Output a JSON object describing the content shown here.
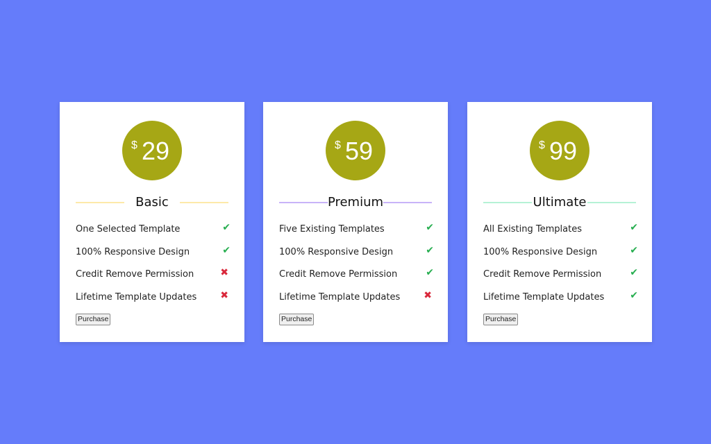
{
  "plans": [
    {
      "currency": "$",
      "price": "29",
      "name": "Basic",
      "accent": "#fde9a9",
      "features": [
        {
          "label": "One Selected Template",
          "included": true
        },
        {
          "label": "100% Responsive Design",
          "included": true
        },
        {
          "label": "Credit Remove Permission",
          "included": false
        },
        {
          "label": "Lifetime Template Updates",
          "included": false
        }
      ],
      "button": "Purchase"
    },
    {
      "currency": "$",
      "price": "59",
      "name": "Premium",
      "accent": "#c8b3f8",
      "features": [
        {
          "label": "Five Existing Templates",
          "included": true
        },
        {
          "label": "100% Responsive Design",
          "included": true
        },
        {
          "label": "Credit Remove Permission",
          "included": true
        },
        {
          "label": "Lifetime Template Updates",
          "included": false
        }
      ],
      "button": "Purchase"
    },
    {
      "currency": "$",
      "price": "99",
      "name": "Ultimate",
      "accent": "#b5f2d5",
      "features": [
        {
          "label": "All Existing Templates",
          "included": true
        },
        {
          "label": "100% Responsive Design",
          "included": true
        },
        {
          "label": "Credit Remove Permission",
          "included": true
        },
        {
          "label": "Lifetime Template Updates",
          "included": true
        }
      ],
      "button": "Purchase"
    }
  ],
  "icons": {
    "check": "✔",
    "cross": "✖"
  },
  "colors": {
    "background": "#657cfa",
    "price_circle": "#a6a715",
    "check": "#27ae50",
    "cross": "#d9283b"
  }
}
